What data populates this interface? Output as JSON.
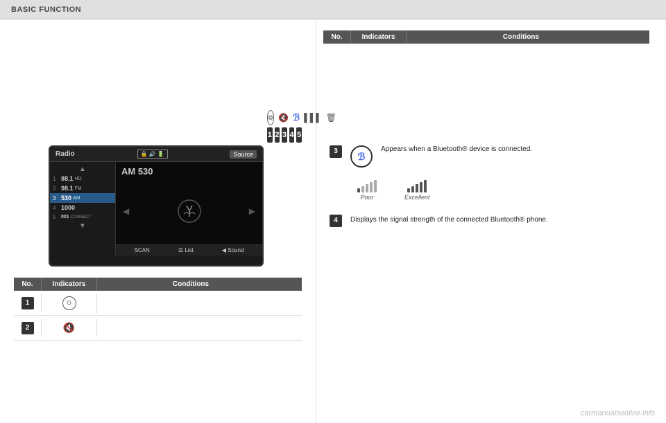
{
  "header": {
    "title": "BASIC FUNCTION"
  },
  "top_table": {
    "columns": [
      "No.",
      "Indicators",
      "Conditions"
    ]
  },
  "bottom_table_left": {
    "columns": [
      "No.",
      "Indicators",
      "Conditions"
    ],
    "rows": [
      {
        "no": "1",
        "indicator": "circle",
        "condition": ""
      },
      {
        "no": "2",
        "indicator": "mute",
        "condition": ""
      }
    ]
  },
  "radio": {
    "title": "Radio",
    "am_freq": "AM 530",
    "stations": [
      {
        "num": "1",
        "freq": "88.1",
        "type": "HD",
        "name": ""
      },
      {
        "num": "2",
        "freq": "98.1",
        "type": "FM",
        "name": ""
      },
      {
        "num": "3",
        "freq": "530",
        "type": "AM",
        "name": "",
        "active": true
      },
      {
        "num": "4",
        "freq": "1000",
        "type": "",
        "name": ""
      },
      {
        "num": "5",
        "freq": "001",
        "type": "CONNECT",
        "name": ""
      }
    ],
    "bottom_buttons": [
      "SCAN",
      "List",
      "Sound"
    ]
  },
  "numbered_boxes": [
    "1",
    "2",
    "3",
    "4",
    "5"
  ],
  "row3": {
    "badge": "3",
    "bt_symbol": "ℬ",
    "text": "Appears when a Bluetooth® device is connected."
  },
  "row4": {
    "badge": "4",
    "text": "Displays the signal strength of the connected Bluetooth® phone."
  },
  "signal_poor": {
    "label": "Poor",
    "bars": [
      true,
      false,
      false,
      false,
      false
    ]
  },
  "signal_excellent": {
    "label": "Excellent",
    "bars": [
      true,
      true,
      true,
      true,
      true
    ]
  },
  "watermark": "carmanualsonline.info",
  "icons": {
    "search": "🔍",
    "mute": "🔇",
    "bluetooth": "ℬ",
    "signal": "📶",
    "delete": "🗑"
  }
}
